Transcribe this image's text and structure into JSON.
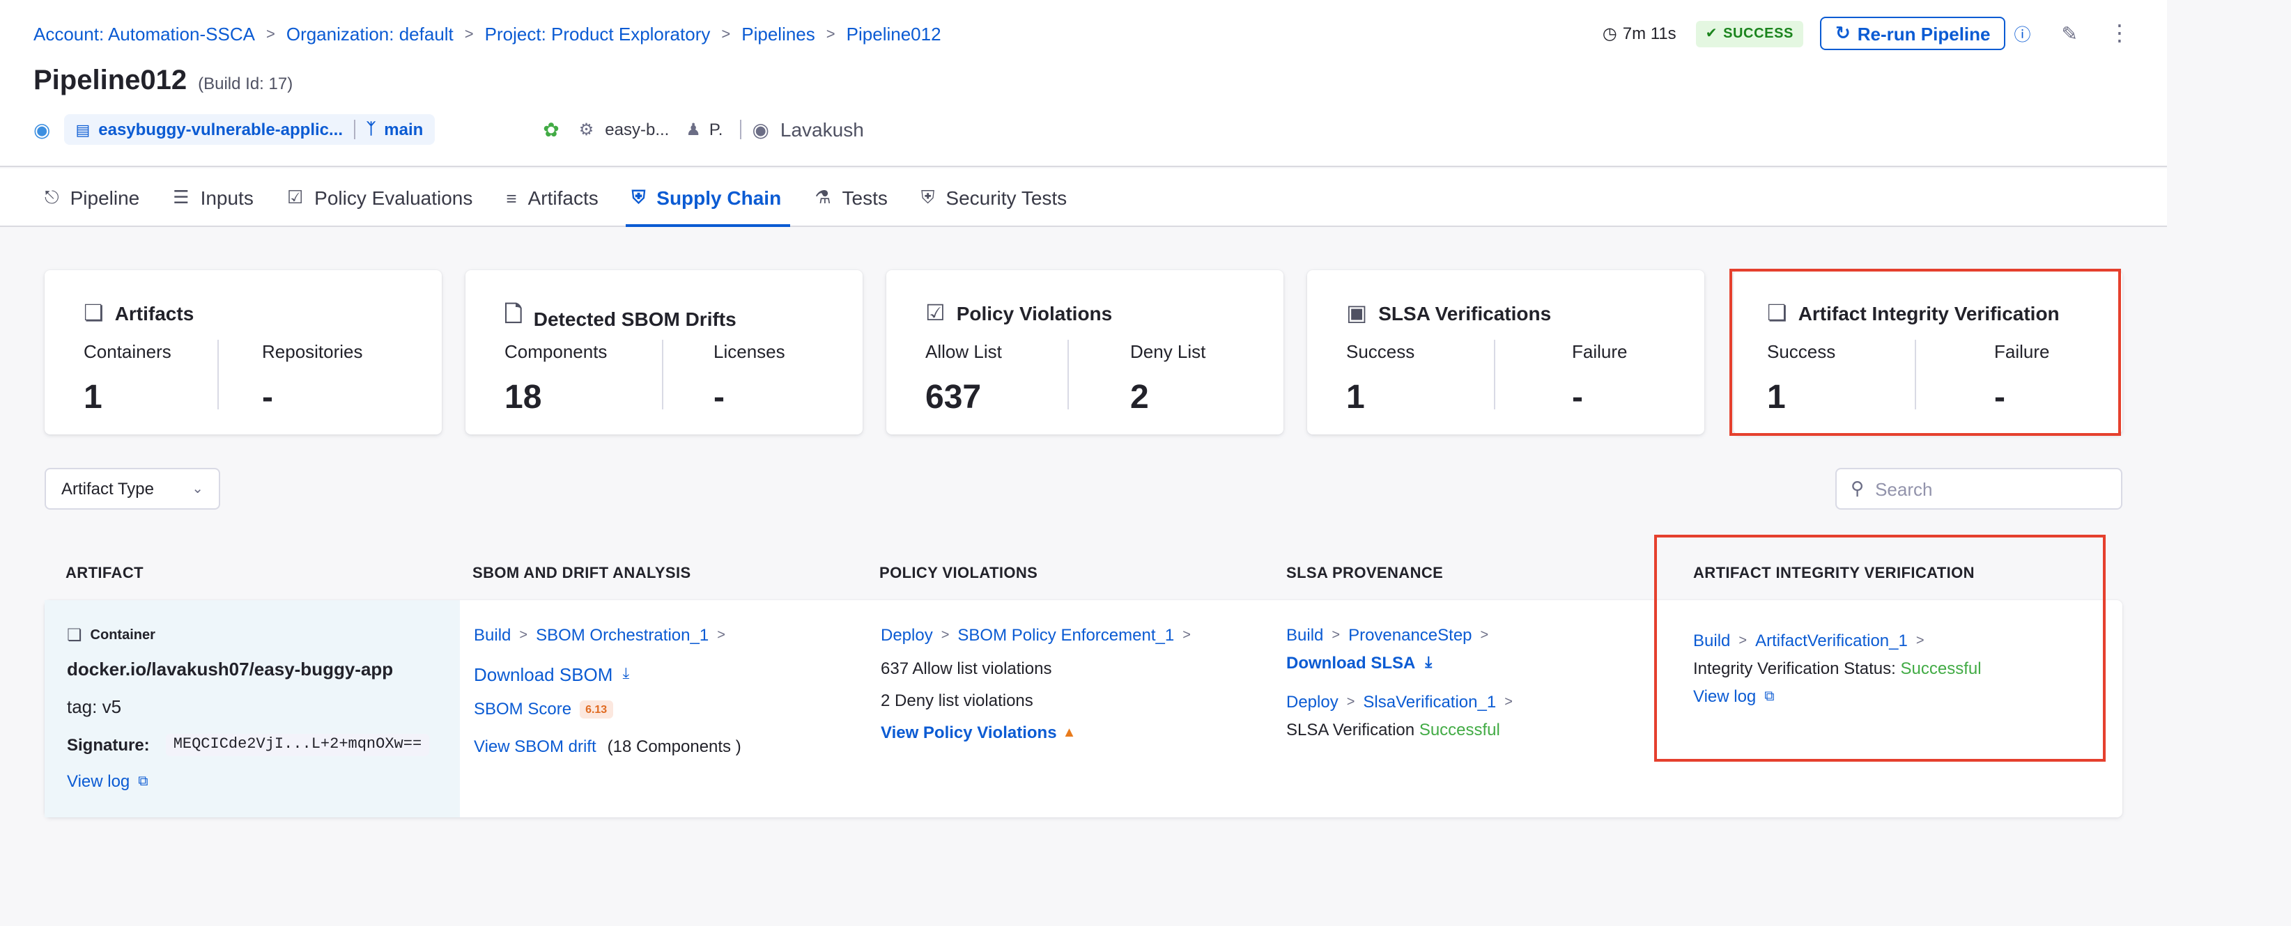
{
  "breadcrumb": [
    "Account: Automation-SSCA",
    "Organization: default",
    "Project: Product Exploratory",
    "Pipelines",
    "Pipeline012"
  ],
  "header": {
    "title": "Pipeline012",
    "build_id": "(Build Id: 17)",
    "repo": "easybuggy-vulnerable-applic...",
    "branch": "main",
    "stage": "easy-b...",
    "trigger": "P.",
    "user": "Lavakush",
    "duration": "7m 11s",
    "status": "SUCCESS",
    "rerun": "Re-run Pipeline"
  },
  "tabs": [
    {
      "label": "Pipeline",
      "icon": "pipeline-icon"
    },
    {
      "label": "Inputs",
      "icon": "inputs-icon"
    },
    {
      "label": "Policy Evaluations",
      "icon": "policy-icon"
    },
    {
      "label": "Artifacts",
      "icon": "artifacts-icon"
    },
    {
      "label": "Supply Chain",
      "icon": "supply-chain-icon"
    },
    {
      "label": "Tests",
      "icon": "tests-icon"
    },
    {
      "label": "Security Tests",
      "icon": "security-icon"
    }
  ],
  "cards": [
    {
      "title": "Artifacts",
      "left_label": "Containers",
      "left_value": "1",
      "right_label": "Repositories",
      "right_value": "-"
    },
    {
      "title": "Detected SBOM Drifts",
      "left_label": "Components",
      "left_value": "18",
      "right_label": "Licenses",
      "right_value": "-"
    },
    {
      "title": "Policy Violations",
      "left_label": "Allow List",
      "left_value": "637",
      "right_label": "Deny List",
      "right_value": "2"
    },
    {
      "title": "SLSA Verifications",
      "left_label": "Success",
      "left_value": "1",
      "right_label": "Failure",
      "right_value": "-"
    },
    {
      "title": "Artifact Integrity Verification",
      "left_label": "Success",
      "left_value": "1",
      "right_label": "Failure",
      "right_value": "-"
    }
  ],
  "filters": {
    "artifact_type": "Artifact Type",
    "search_placeholder": "Search"
  },
  "columns": [
    "ARTIFACT",
    "SBOM AND DRIFT ANALYSIS",
    "POLICY VIOLATIONS",
    "SLSA PROVENANCE",
    "ARTIFACT INTEGRITY VERIFICATION"
  ],
  "row": {
    "artifact": {
      "type": "Container",
      "name": "docker.io/lavakush07/easy-buggy-app",
      "tag": "tag: v5",
      "signature_label": "Signature:",
      "signature": "MEQCICde2VjI...L+2+mqnOXw==",
      "view_log": "View log"
    },
    "sbom": {
      "stage": "Build",
      "step": "SBOM Orchestration_1",
      "download": "Download SBOM",
      "score_label": "SBOM Score",
      "score": "6.13",
      "drift_link": "View SBOM drift",
      "drift_count": "(18 Components )"
    },
    "policy": {
      "stage": "Deploy",
      "step": "SBOM Policy Enforcement_1",
      "allow": "637 Allow list violations",
      "deny": "2 Deny list violations",
      "view": "View Policy Violations"
    },
    "slsa": {
      "stage1": "Build",
      "step1": "ProvenanceStep",
      "download": "Download SLSA",
      "stage2": "Deploy",
      "step2": "SlsaVerification_1",
      "verification_label": "SLSA Verification",
      "verification_status": "Successful"
    },
    "integrity": {
      "stage": "Build",
      "step": "ArtifactVerification_1",
      "status_label": "Integrity Verification Status:",
      "status": "Successful",
      "view_log": "View log"
    }
  },
  "colors": {
    "accent": "#0b5bd3",
    "success": "#42ab45",
    "highlight": "#e5402e"
  }
}
